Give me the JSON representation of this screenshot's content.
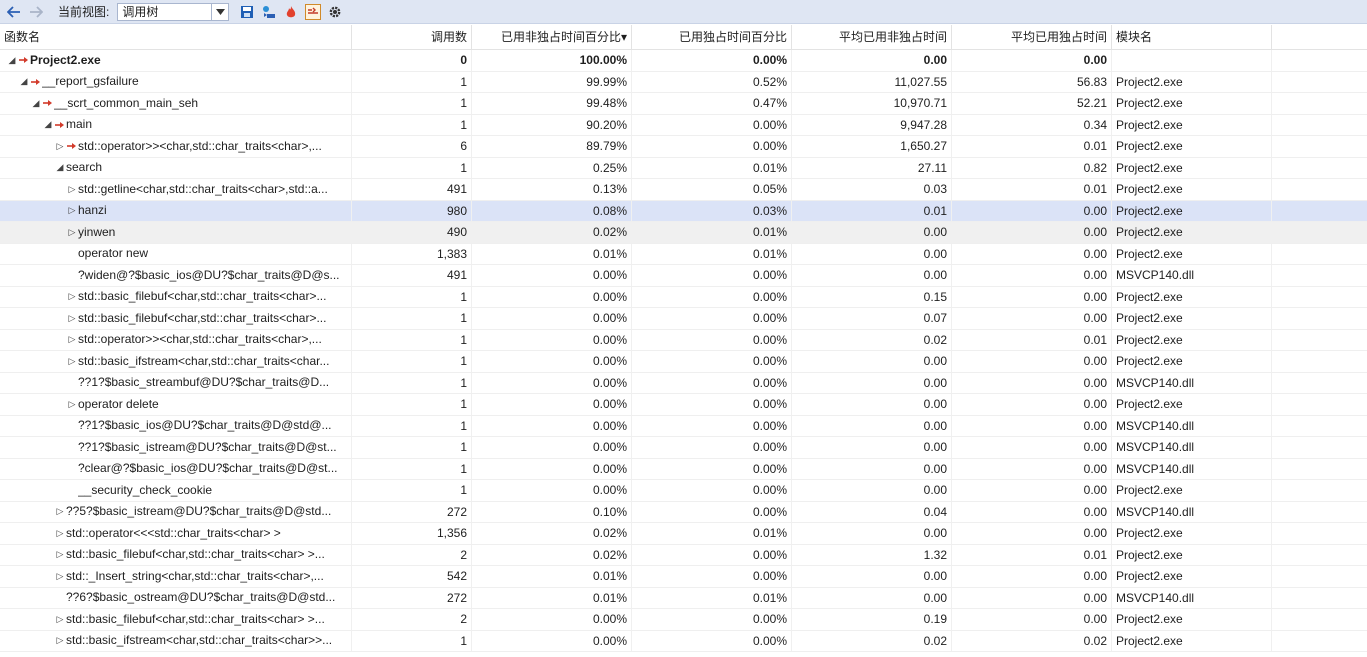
{
  "toolbar": {
    "view_label": "当前视图:",
    "view_value": "调用树",
    "icons": [
      "back-arrow-icon",
      "forward-arrow-icon",
      "save-icon",
      "export-icon",
      "hot-path-icon",
      "flame-icon",
      "settings-gear-icon"
    ]
  },
  "columns": [
    "函数名",
    "调用数",
    "已用非独占时间百分比",
    "已用独占时间百分比",
    "平均已用非独占时间",
    "平均已用独占时间",
    "模块名"
  ],
  "sort_indicator": "▾",
  "rows": [
    {
      "indent": 0,
      "tw": "◢",
      "hot": true,
      "bold": true,
      "name": "Project2.exe",
      "calls": "0",
      "incl": "100.00%",
      "excl": "0.00%",
      "avg_incl": "0.00",
      "avg_excl": "0.00",
      "module": ""
    },
    {
      "indent": 1,
      "tw": "◢",
      "hot": true,
      "bold": false,
      "name": "__report_gsfailure",
      "calls": "1",
      "incl": "99.99%",
      "excl": "0.52%",
      "avg_incl": "11,027.55",
      "avg_excl": "56.83",
      "module": "Project2.exe"
    },
    {
      "indent": 2,
      "tw": "◢",
      "hot": true,
      "bold": false,
      "name": "__scrt_common_main_seh",
      "calls": "1",
      "incl": "99.48%",
      "excl": "0.47%",
      "avg_incl": "10,970.71",
      "avg_excl": "52.21",
      "module": "Project2.exe"
    },
    {
      "indent": 3,
      "tw": "◢",
      "hot": true,
      "bold": false,
      "name": "main",
      "calls": "1",
      "incl": "90.20%",
      "excl": "0.00%",
      "avg_incl": "9,947.28",
      "avg_excl": "0.34",
      "module": "Project2.exe"
    },
    {
      "indent": 4,
      "tw": "▷",
      "hot": true,
      "bold": false,
      "name": "std::operator>><char,std::char_traits<char>,...",
      "calls": "6",
      "incl": "89.79%",
      "excl": "0.00%",
      "avg_incl": "1,650.27",
      "avg_excl": "0.01",
      "module": "Project2.exe"
    },
    {
      "indent": 4,
      "tw": "◢",
      "hot": false,
      "bold": false,
      "name": "search",
      "calls": "1",
      "incl": "0.25%",
      "excl": "0.01%",
      "avg_incl": "27.11",
      "avg_excl": "0.82",
      "module": "Project2.exe"
    },
    {
      "indent": 5,
      "tw": "▷",
      "hot": false,
      "bold": false,
      "name": "std::getline<char,std::char_traits<char>,std::a...",
      "calls": "491",
      "incl": "0.13%",
      "excl": "0.05%",
      "avg_incl": "0.03",
      "avg_excl": "0.01",
      "module": "Project2.exe"
    },
    {
      "indent": 5,
      "tw": "▷",
      "hot": false,
      "bold": false,
      "name": "hanzi",
      "calls": "980",
      "incl": "0.08%",
      "excl": "0.03%",
      "avg_incl": "0.01",
      "avg_excl": "0.00",
      "module": "Project2.exe",
      "state": "sel"
    },
    {
      "indent": 5,
      "tw": "▷",
      "hot": false,
      "bold": false,
      "name": "yinwen",
      "calls": "490",
      "incl": "0.02%",
      "excl": "0.01%",
      "avg_incl": "0.00",
      "avg_excl": "0.00",
      "module": "Project2.exe",
      "state": "hov"
    },
    {
      "indent": 5,
      "tw": "",
      "hot": false,
      "bold": false,
      "name": "operator new",
      "calls": "1,383",
      "incl": "0.01%",
      "excl": "0.01%",
      "avg_incl": "0.00",
      "avg_excl": "0.00",
      "module": "Project2.exe"
    },
    {
      "indent": 5,
      "tw": "",
      "hot": false,
      "bold": false,
      "name": "?widen@?$basic_ios@DU?$char_traits@D@s...",
      "calls": "491",
      "incl": "0.00%",
      "excl": "0.00%",
      "avg_incl": "0.00",
      "avg_excl": "0.00",
      "module": "MSVCP140.dll"
    },
    {
      "indent": 5,
      "tw": "▷",
      "hot": false,
      "bold": false,
      "name": "std::basic_filebuf<char,std::char_traits<char>...",
      "calls": "1",
      "incl": "0.00%",
      "excl": "0.00%",
      "avg_incl": "0.15",
      "avg_excl": "0.00",
      "module": "Project2.exe"
    },
    {
      "indent": 5,
      "tw": "▷",
      "hot": false,
      "bold": false,
      "name": "std::basic_filebuf<char,std::char_traits<char>...",
      "calls": "1",
      "incl": "0.00%",
      "excl": "0.00%",
      "avg_incl": "0.07",
      "avg_excl": "0.00",
      "module": "Project2.exe"
    },
    {
      "indent": 5,
      "tw": "▷",
      "hot": false,
      "bold": false,
      "name": "std::operator>><char,std::char_traits<char>,...",
      "calls": "1",
      "incl": "0.00%",
      "excl": "0.00%",
      "avg_incl": "0.02",
      "avg_excl": "0.01",
      "module": "Project2.exe"
    },
    {
      "indent": 5,
      "tw": "▷",
      "hot": false,
      "bold": false,
      "name": "std::basic_ifstream<char,std::char_traits<char...",
      "calls": "1",
      "incl": "0.00%",
      "excl": "0.00%",
      "avg_incl": "0.00",
      "avg_excl": "0.00",
      "module": "Project2.exe"
    },
    {
      "indent": 5,
      "tw": "",
      "hot": false,
      "bold": false,
      "name": "??1?$basic_streambuf@DU?$char_traits@D...",
      "calls": "1",
      "incl": "0.00%",
      "excl": "0.00%",
      "avg_incl": "0.00",
      "avg_excl": "0.00",
      "module": "MSVCP140.dll"
    },
    {
      "indent": 5,
      "tw": "▷",
      "hot": false,
      "bold": false,
      "name": "operator delete",
      "calls": "1",
      "incl": "0.00%",
      "excl": "0.00%",
      "avg_incl": "0.00",
      "avg_excl": "0.00",
      "module": "Project2.exe"
    },
    {
      "indent": 5,
      "tw": "",
      "hot": false,
      "bold": false,
      "name": "??1?$basic_ios@DU?$char_traits@D@std@...",
      "calls": "1",
      "incl": "0.00%",
      "excl": "0.00%",
      "avg_incl": "0.00",
      "avg_excl": "0.00",
      "module": "MSVCP140.dll"
    },
    {
      "indent": 5,
      "tw": "",
      "hot": false,
      "bold": false,
      "name": "??1?$basic_istream@DU?$char_traits@D@st...",
      "calls": "1",
      "incl": "0.00%",
      "excl": "0.00%",
      "avg_incl": "0.00",
      "avg_excl": "0.00",
      "module": "MSVCP140.dll"
    },
    {
      "indent": 5,
      "tw": "",
      "hot": false,
      "bold": false,
      "name": "?clear@?$basic_ios@DU?$char_traits@D@st...",
      "calls": "1",
      "incl": "0.00%",
      "excl": "0.00%",
      "avg_incl": "0.00",
      "avg_excl": "0.00",
      "module": "MSVCP140.dll"
    },
    {
      "indent": 5,
      "tw": "",
      "hot": false,
      "bold": false,
      "name": "__security_check_cookie",
      "calls": "1",
      "incl": "0.00%",
      "excl": "0.00%",
      "avg_incl": "0.00",
      "avg_excl": "0.00",
      "module": "Project2.exe"
    },
    {
      "indent": 4,
      "tw": "▷",
      "hot": false,
      "bold": false,
      "name": "??5?$basic_istream@DU?$char_traits@D@std...",
      "calls": "272",
      "incl": "0.10%",
      "excl": "0.00%",
      "avg_incl": "0.04",
      "avg_excl": "0.00",
      "module": "MSVCP140.dll"
    },
    {
      "indent": 4,
      "tw": "▷",
      "hot": false,
      "bold": false,
      "name": "std::operator<<<std::char_traits<char> >",
      "calls": "1,356",
      "incl": "0.02%",
      "excl": "0.01%",
      "avg_incl": "0.00",
      "avg_excl": "0.00",
      "module": "Project2.exe"
    },
    {
      "indent": 4,
      "tw": "▷",
      "hot": false,
      "bold": false,
      "name": "std::basic_filebuf<char,std::char_traits<char> >...",
      "calls": "2",
      "incl": "0.02%",
      "excl": "0.00%",
      "avg_incl": "1.32",
      "avg_excl": "0.01",
      "module": "Project2.exe"
    },
    {
      "indent": 4,
      "tw": "▷",
      "hot": false,
      "bold": false,
      "name": "std::_Insert_string<char,std::char_traits<char>,...",
      "calls": "542",
      "incl": "0.01%",
      "excl": "0.00%",
      "avg_incl": "0.00",
      "avg_excl": "0.00",
      "module": "Project2.exe"
    },
    {
      "indent": 4,
      "tw": "",
      "hot": false,
      "bold": false,
      "name": "??6?$basic_ostream@DU?$char_traits@D@std...",
      "calls": "272",
      "incl": "0.01%",
      "excl": "0.01%",
      "avg_incl": "0.00",
      "avg_excl": "0.00",
      "module": "MSVCP140.dll"
    },
    {
      "indent": 4,
      "tw": "▷",
      "hot": false,
      "bold": false,
      "name": "std::basic_filebuf<char,std::char_traits<char> >...",
      "calls": "2",
      "incl": "0.00%",
      "excl": "0.00%",
      "avg_incl": "0.19",
      "avg_excl": "0.00",
      "module": "Project2.exe"
    },
    {
      "indent": 4,
      "tw": "▷",
      "hot": false,
      "bold": false,
      "name": "std::basic_ifstream<char,std::char_traits<char>>...",
      "calls": "1",
      "incl": "0.00%",
      "excl": "0.00%",
      "avg_incl": "0.02",
      "avg_excl": "0.02",
      "module": "Project2.exe"
    }
  ]
}
